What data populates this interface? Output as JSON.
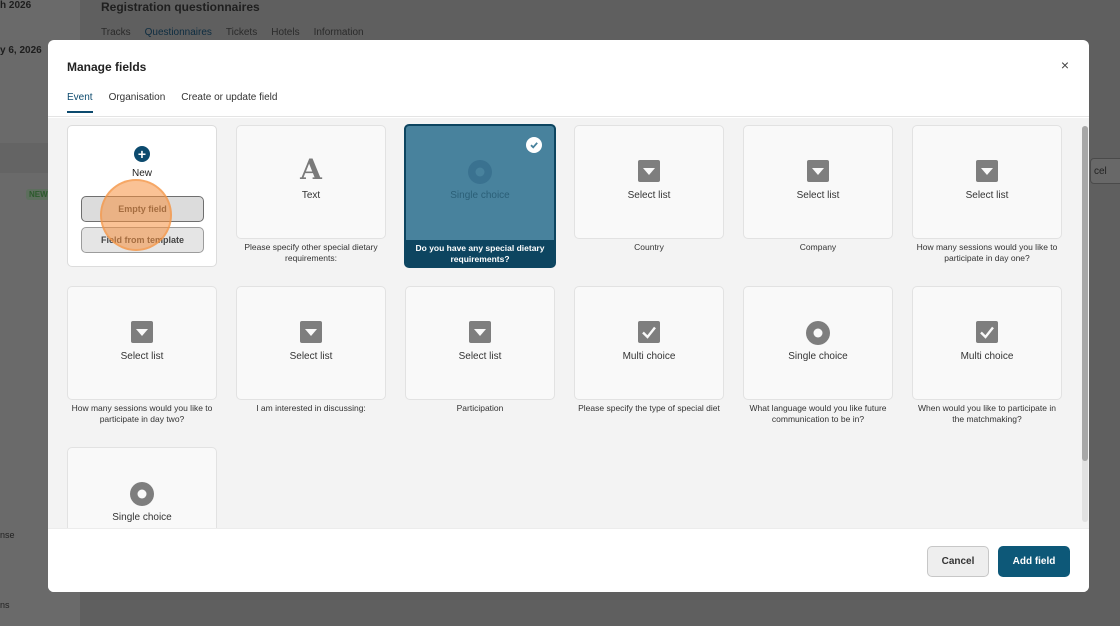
{
  "background": {
    "sidebar_dates": [
      "h 2026",
      "y 6, 2026"
    ],
    "sidebar_badge": "NEW",
    "sidebar_bottom": [
      "nse",
      "ns"
    ],
    "page_title": "Registration questionnaires",
    "tabs": [
      "Tracks",
      "Questionnaires",
      "Tickets",
      "Hotels",
      "Information"
    ],
    "cancel_partial": "cel"
  },
  "modal": {
    "title": "Manage fields",
    "close_icon": "×",
    "tabs": [
      "Event",
      "Organisation",
      "Create or update field"
    ],
    "active_tab": "Event",
    "new_card": {
      "plus": "+",
      "label": "New",
      "empty_button": "Empty field",
      "template_button": "Field from template"
    },
    "fields": [
      {
        "type": "Text",
        "icon": "text-icon",
        "glyph": "A",
        "caption": "Please specify other special dietary requirements:"
      },
      {
        "type": "Single choice",
        "icon": "radio-icon",
        "caption": "Do you have any special dietary requirements?",
        "selected": true
      },
      {
        "type": "Select list",
        "icon": "dropdown-icon",
        "caption": "Country"
      },
      {
        "type": "Select list",
        "icon": "dropdown-icon",
        "caption": "Company"
      },
      {
        "type": "Select list",
        "icon": "dropdown-icon",
        "caption": "How many sessions would you like to participate in day one?"
      },
      {
        "type": "Select list",
        "icon": "dropdown-icon",
        "caption": "How many sessions would you like to participate in day two?"
      },
      {
        "type": "Select list",
        "icon": "dropdown-icon",
        "caption": "I am interested in discussing:"
      },
      {
        "type": "Select list",
        "icon": "dropdown-icon",
        "caption": "Participation"
      },
      {
        "type": "Multi choice",
        "icon": "checkbox-icon",
        "caption": "Please specify the type of special diet"
      },
      {
        "type": "Single choice",
        "icon": "radio-icon",
        "caption": "What language would you like future communication to be in?"
      },
      {
        "type": "Multi choice",
        "icon": "checkbox-icon",
        "caption": "When would you like to participate in the matchmaking?"
      },
      {
        "type": "Single choice",
        "icon": "radio-icon",
        "caption": ""
      }
    ],
    "footer": {
      "cancel_label": "Cancel",
      "add_label": "Add field"
    }
  }
}
